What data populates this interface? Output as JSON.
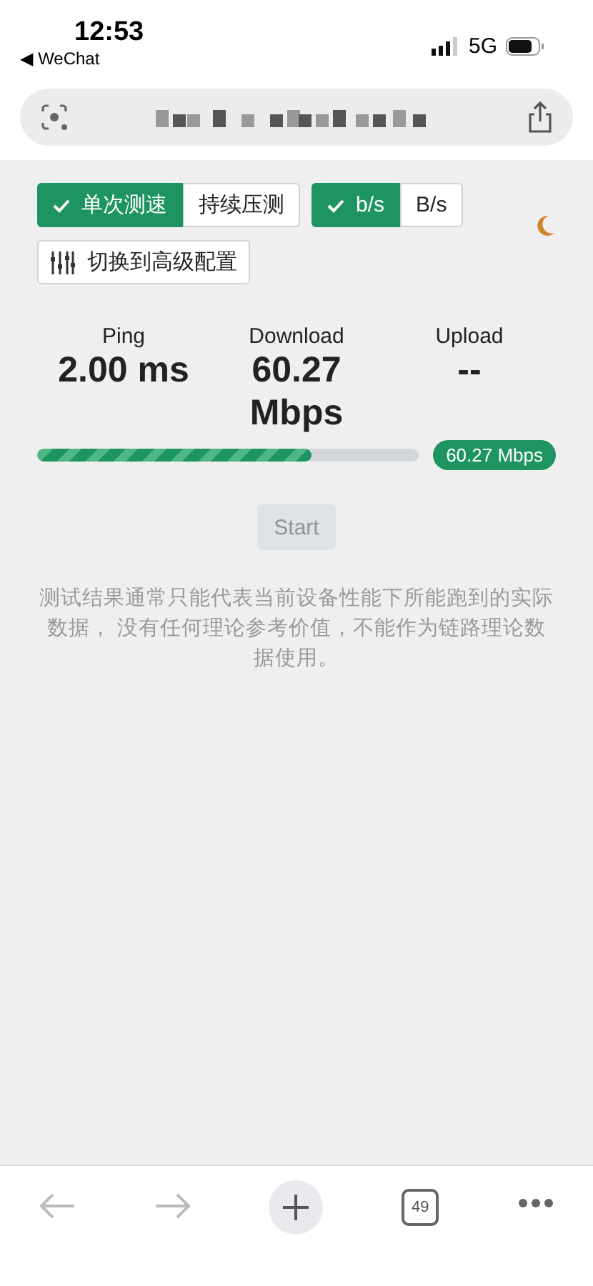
{
  "status_bar": {
    "time": "12:53",
    "back_app": "◀ WeChat",
    "network": "5G"
  },
  "mode_toggle": [
    {
      "label": "单次测速",
      "selected": true
    },
    {
      "label": "持续压测",
      "selected": false
    }
  ],
  "unit_toggle": [
    {
      "label": "b/s",
      "selected": true
    },
    {
      "label": "B/s",
      "selected": false
    }
  ],
  "advanced_button": "切换到高级配置",
  "metrics": [
    {
      "label": "Ping",
      "value": "2.00 ms"
    },
    {
      "label": "Download",
      "value": "60.27 Mbps"
    },
    {
      "label": "Upload",
      "value": "--"
    }
  ],
  "progress": {
    "level": 0.72,
    "reading": "60.27 Mbps"
  },
  "start_button": {
    "label": "Start",
    "disabled": true
  },
  "note": "测试结果通常只能代表当前设备性能下所能跑到的实际数据， 没有任何理论参考价值，不能作为链路理论数据使用。",
  "toolbar": {
    "tab_count": "49"
  }
}
